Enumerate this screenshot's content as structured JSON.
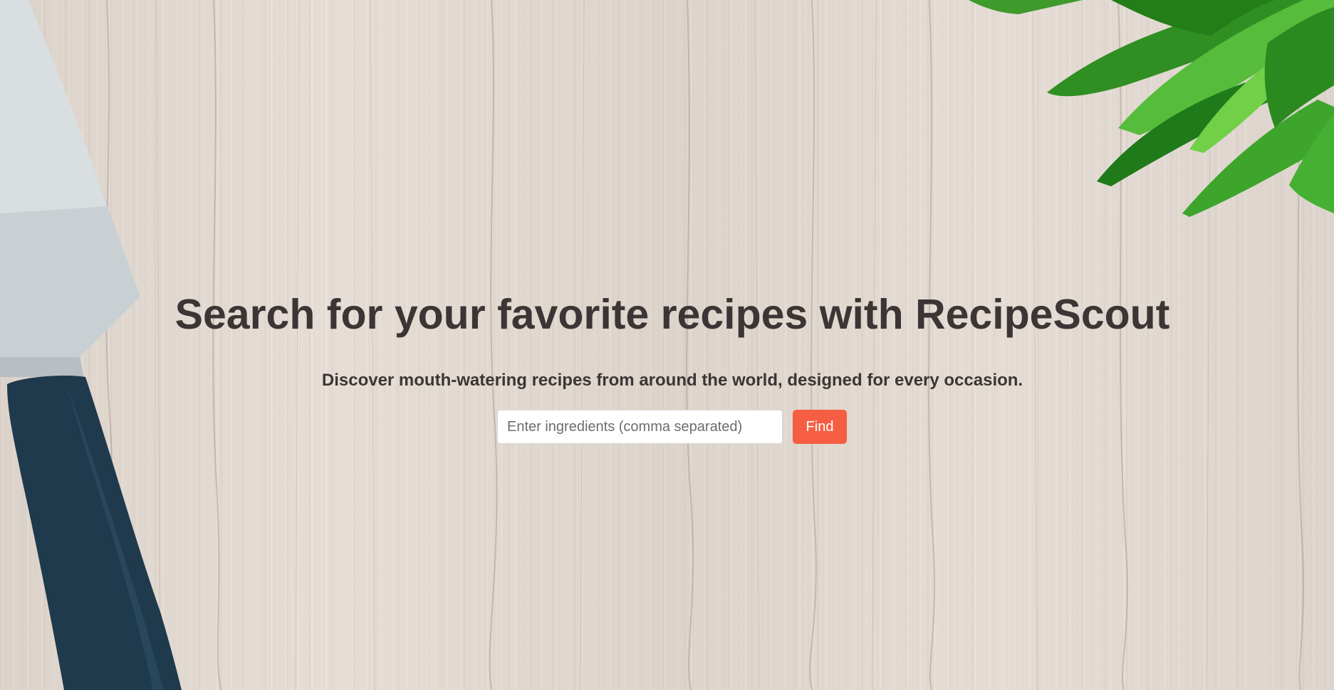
{
  "hero": {
    "title": "Search for your favorite recipes with RecipeScout",
    "subtitle": "Discover mouth-watering recipes from around the world, designed for every occasion."
  },
  "search": {
    "placeholder": "Enter ingredients (comma separated)",
    "value": "",
    "button_label": "Find"
  },
  "colors": {
    "button_accent": "#f65e43",
    "heading_text": "#3b3535",
    "wood_background": "#e2d9d1"
  },
  "icons": {
    "knife": "knife-image",
    "herbs": "herb-leaves-image"
  }
}
